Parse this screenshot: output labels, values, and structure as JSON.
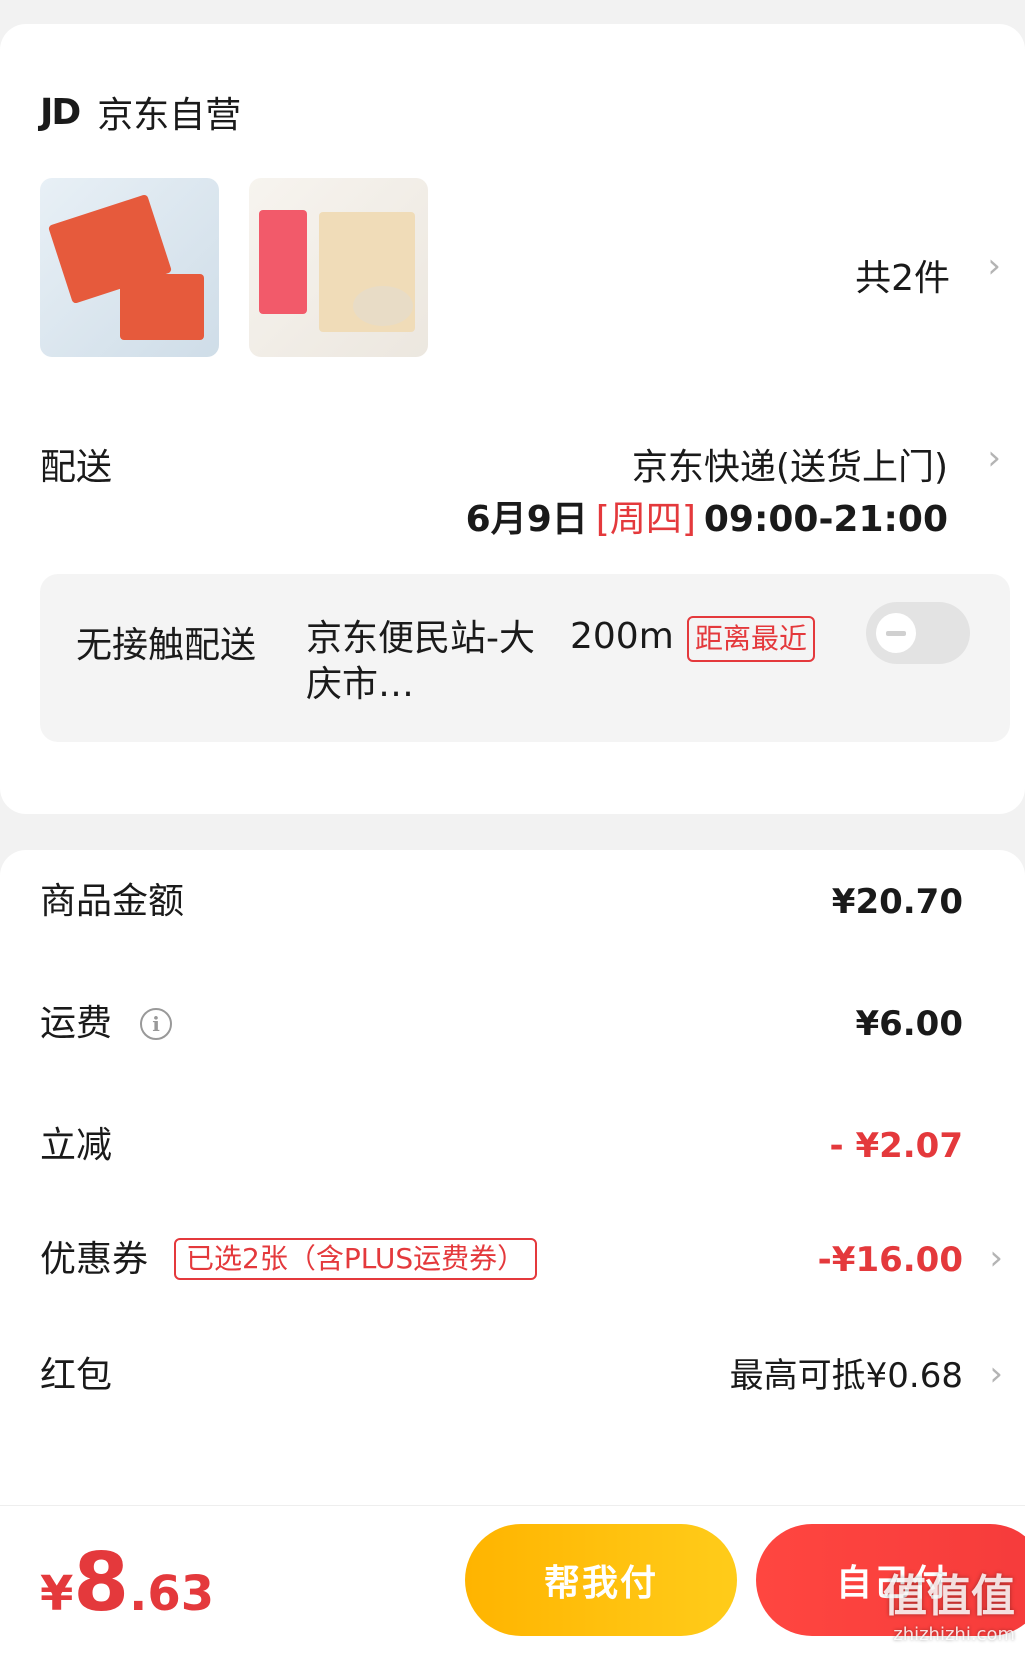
{
  "store": {
    "logo_text": "JD",
    "name": "京东自营",
    "item_count": "共2件"
  },
  "shipping": {
    "label": "配送",
    "method": "京东快递(送货上门)",
    "date": "6月9日",
    "weekday": "[周四]",
    "time": "09:00-21:00"
  },
  "no_contact": {
    "title": "无接触配送",
    "station": "京东便民站-大庆市…",
    "distance": "200m",
    "badge": "距离最近",
    "enabled": false
  },
  "fees": {
    "goods_label": "商品金额",
    "goods_value": "¥20.70",
    "freight_label": "运费",
    "freight_value": "¥6.00",
    "discount_label": "立减",
    "discount_value": "- ¥2.07",
    "coupon_label": "优惠券",
    "coupon_tag": "已选2张（含PLUS运费券）",
    "coupon_value": "-¥16.00",
    "redpacket_label": "红包",
    "redpacket_value": "最高可抵¥0.68"
  },
  "footer": {
    "total_yen": "¥",
    "total_int": "8",
    "total_dec": ".63",
    "help_pay": "帮我付",
    "self_pay": "自己付"
  },
  "watermark": {
    "main": "值值值",
    "sub": "zhizhizhi.com"
  },
  "colors": {
    "accent_red": "#e4393c",
    "help_button": "#ffb400",
    "self_button": "#ff4640"
  }
}
